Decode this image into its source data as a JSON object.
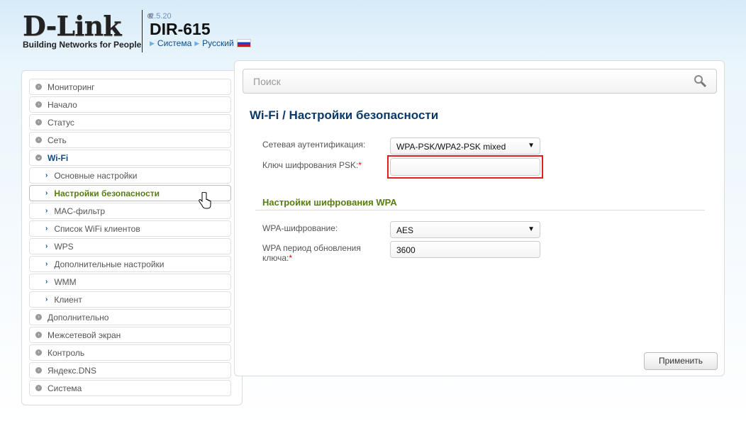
{
  "header": {
    "brand": "D-Link",
    "registered": "®",
    "tagline": "Building Networks for People",
    "firmware": "2.5.20",
    "model": "DIR-615",
    "links": [
      "Система",
      "Русский"
    ]
  },
  "sidebar": {
    "items": [
      {
        "label": "Мониторинг",
        "type": "top"
      },
      {
        "label": "Начало",
        "type": "top"
      },
      {
        "label": "Статус",
        "type": "top"
      },
      {
        "label": "Сеть",
        "type": "top"
      },
      {
        "label": "Wi-Fi",
        "type": "open"
      },
      {
        "label": "Основные настройки",
        "type": "sub"
      },
      {
        "label": "Настройки безопасности",
        "type": "active"
      },
      {
        "label": "MAC-фильтр",
        "type": "sub"
      },
      {
        "label": "Список WiFi клиентов",
        "type": "sub"
      },
      {
        "label": "WPS",
        "type": "sub"
      },
      {
        "label": "Дополнительные настройки",
        "type": "sub"
      },
      {
        "label": "WMM",
        "type": "sub"
      },
      {
        "label": "Клиент",
        "type": "sub"
      },
      {
        "label": "Дополнительно",
        "type": "top"
      },
      {
        "label": "Межсетевой экран",
        "type": "top"
      },
      {
        "label": "Контроль",
        "type": "top"
      },
      {
        "label": "Яндекс.DNS",
        "type": "top"
      },
      {
        "label": "Система",
        "type": "top"
      }
    ]
  },
  "main": {
    "search_placeholder": "Поиск",
    "title": "Wi-Fi /  Настройки безопасности",
    "auth_label": "Сетевая аутентификация:",
    "auth_value": "WPA-PSK/WPA2-PSK mixed",
    "psk_label": "Ключ шифрования PSK:",
    "psk_value": "",
    "section": "Настройки шифрования WPA",
    "enc_label": "WPA-шифрование:",
    "enc_value": "AES",
    "period_label": "WPA период обновления ключа:",
    "period_value": "3600",
    "required_mark": "*",
    "apply": "Применить"
  }
}
